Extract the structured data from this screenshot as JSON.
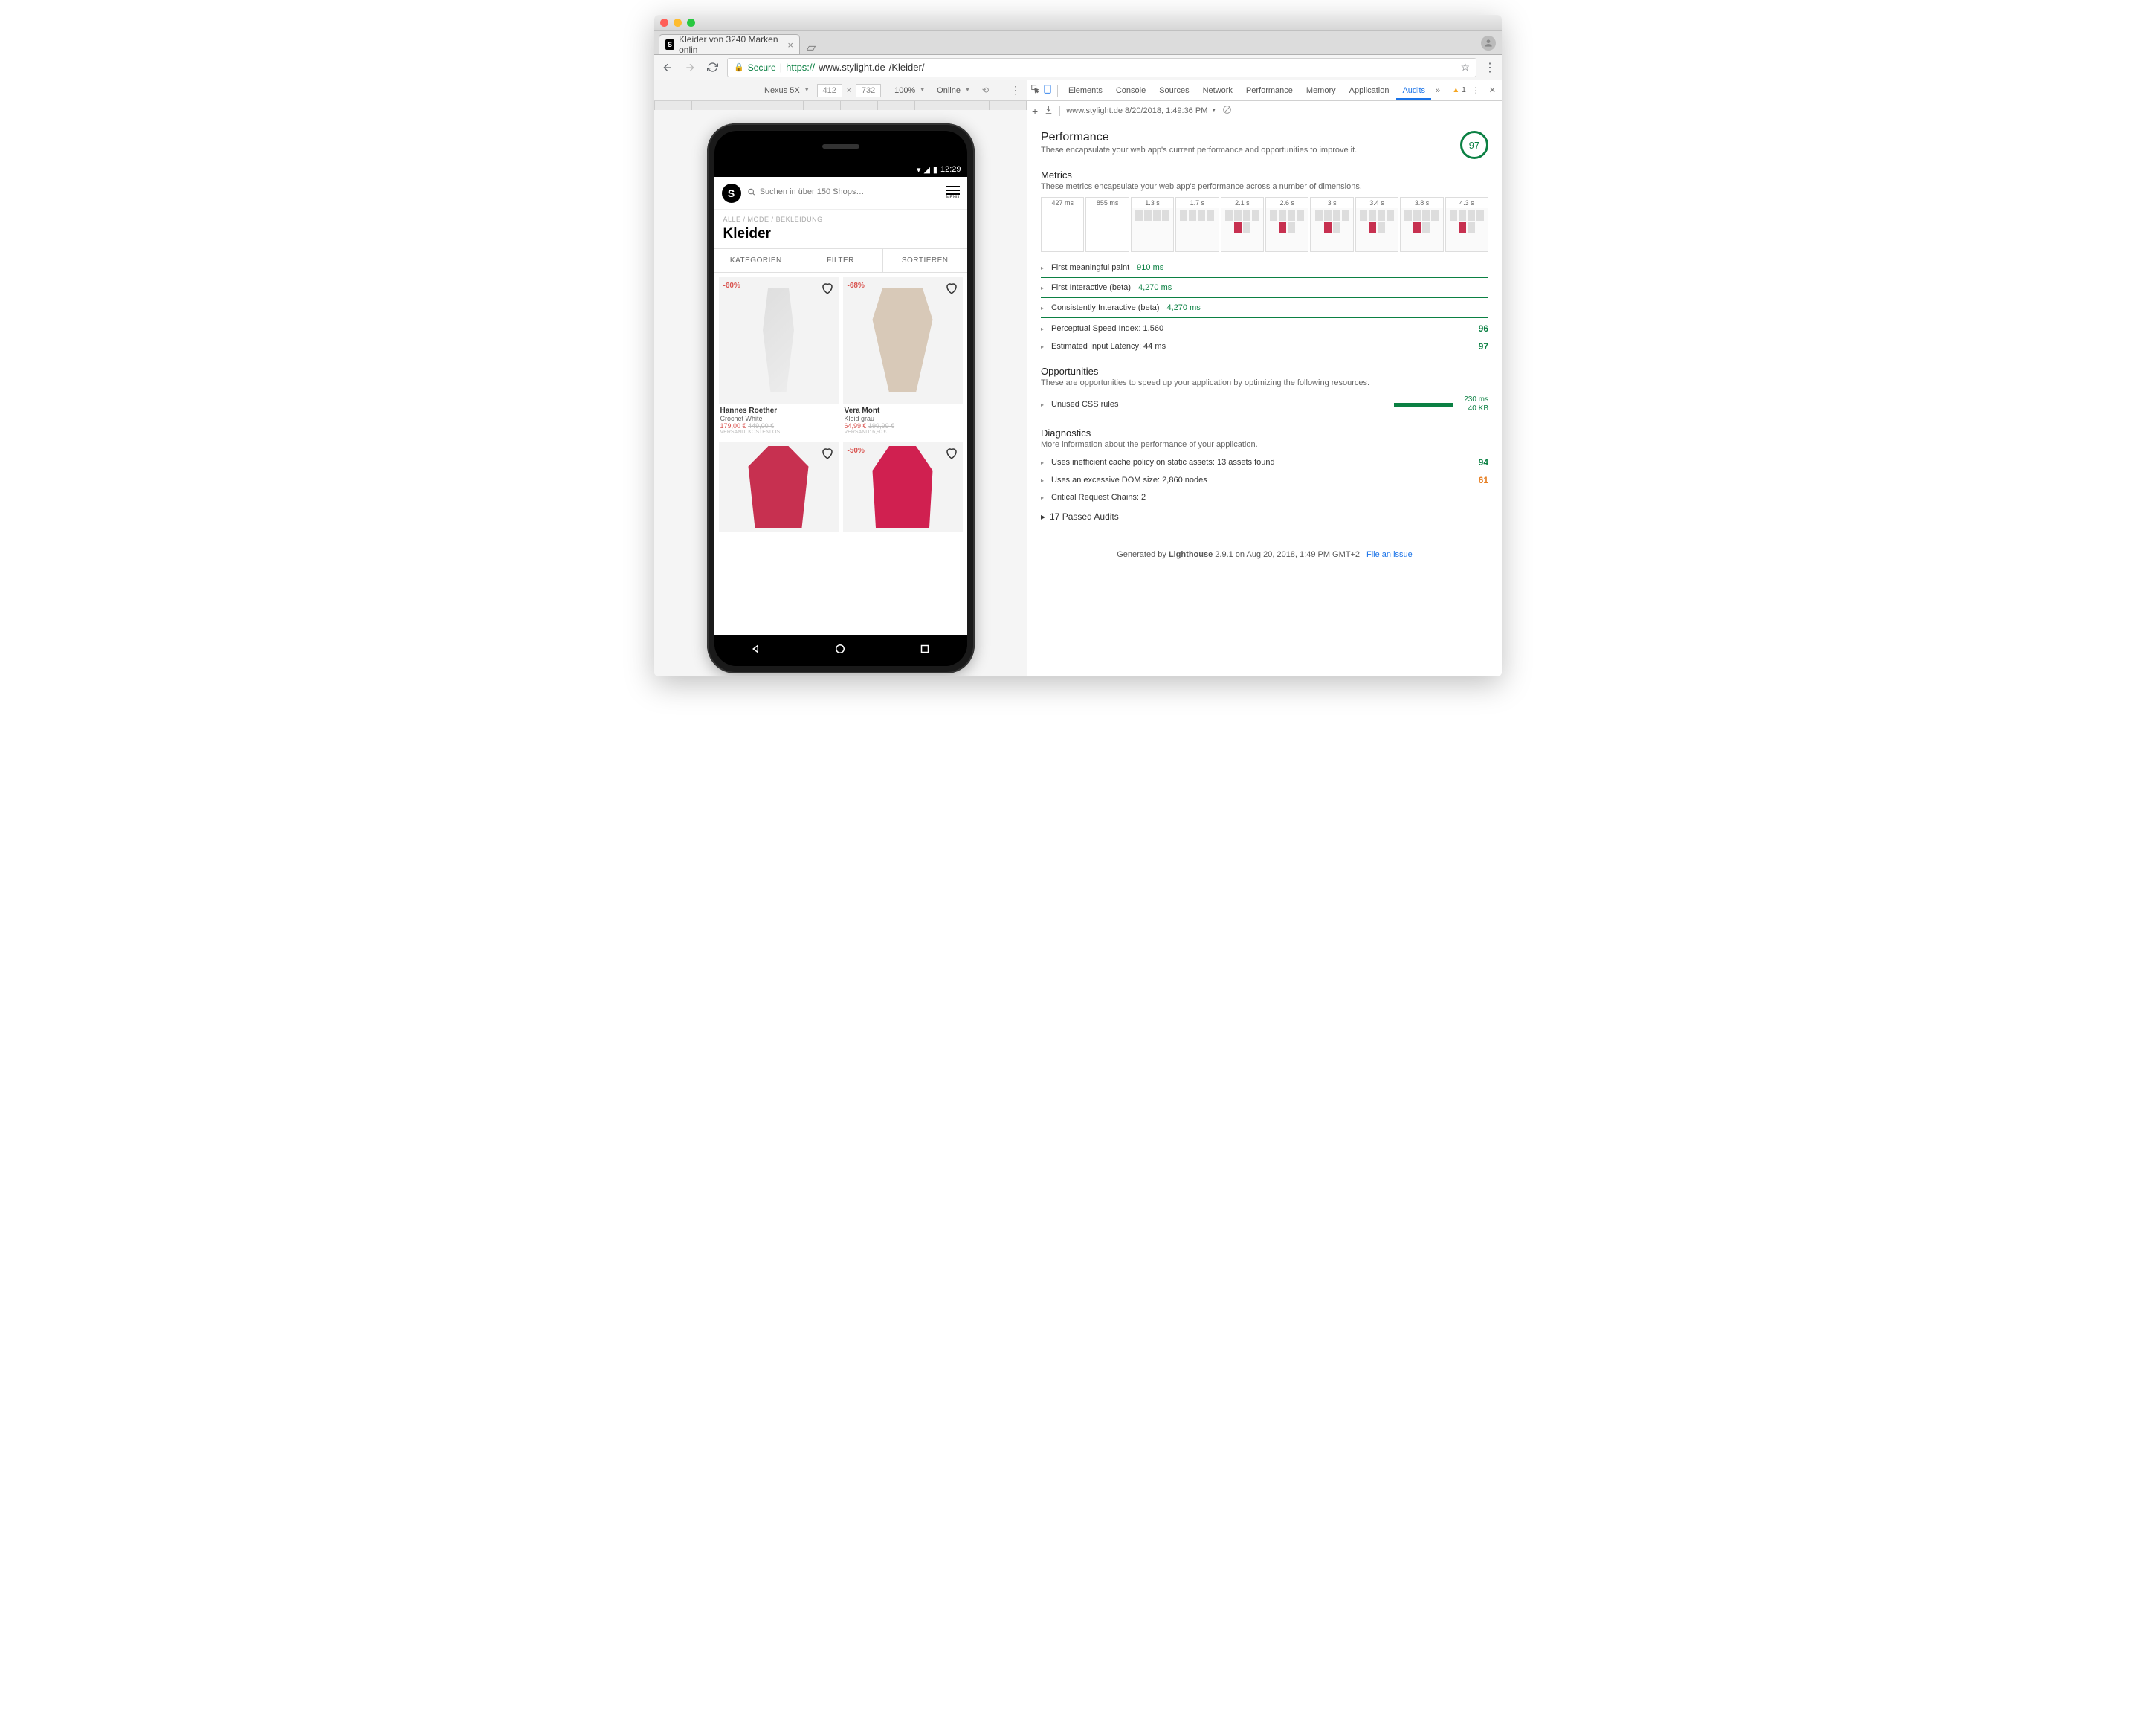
{
  "browser": {
    "tab_title": "Kleider von 3240 Marken onlin",
    "secure_label": "Secure",
    "url_protocol": "https://",
    "url_host": "www.stylight.de",
    "url_path": "/Kleider/"
  },
  "device_toolbar": {
    "device": "Nexus 5X",
    "width": "412",
    "height": "732",
    "zoom": "100%",
    "throttle": "Online"
  },
  "phone": {
    "status_time": "12:29",
    "search_placeholder": "Suchen in über 150 Shops…",
    "menu_label": "MENÜ",
    "crumbs": [
      "ALLE",
      "MODE",
      "BEKLEIDUNG"
    ],
    "heading": "Kleider",
    "tabs": [
      "KATEGORIEN",
      "FILTER",
      "SORTIEREN"
    ],
    "products": [
      {
        "badge": "-60%",
        "brand": "Hannes Roether",
        "name": "Crochet White",
        "sale": "179,00 €",
        "old": "449,00 €",
        "ship": "VERSAND: KOSTENLOS"
      },
      {
        "badge": "-68%",
        "brand": "Vera Mont",
        "name": "Kleid grau",
        "sale": "64,99 €",
        "old": "199,99 €",
        "ship": "VERSAND: 6,90 €"
      },
      {
        "badge": "",
        "brand": "",
        "name": "",
        "sale": "",
        "old": "",
        "ship": ""
      },
      {
        "badge": "-50%",
        "brand": "",
        "name": "",
        "sale": "",
        "old": "",
        "ship": ""
      }
    ]
  },
  "devtools": {
    "tabs": [
      "Elements",
      "Console",
      "Sources",
      "Network",
      "Performance",
      "Memory",
      "Application",
      "Audits"
    ],
    "active_tab": "Audits",
    "warning_count": "1",
    "audit_run": "www.stylight.de 8/20/2018, 1:49:36 PM",
    "performance": {
      "title": "Performance",
      "subtitle": "These encapsulate your web app's current performance and opportunities to improve it.",
      "score": "97"
    },
    "metrics": {
      "title": "Metrics",
      "subtitle": "These metrics encapsulate your web app's performance across a number of dimensions.",
      "timestamps": [
        "427 ms",
        "855 ms",
        "1.3 s",
        "1.7 s",
        "2.1 s",
        "2.6 s",
        "3 s",
        "3.4 s",
        "3.8 s",
        "4.3 s"
      ],
      "items": [
        {
          "label": "First meaningful paint",
          "value": "910 ms",
          "hl": true
        },
        {
          "label": "First Interactive (beta)",
          "value": "4,270 ms",
          "hl": true
        },
        {
          "label": "Consistently Interactive (beta)",
          "value": "4,270 ms",
          "hl": true
        },
        {
          "label": "Perceptual Speed Index: 1,560",
          "value": "",
          "score": "96"
        },
        {
          "label": "Estimated Input Latency: 44 ms",
          "value": "",
          "score": "97"
        }
      ]
    },
    "opportunities": {
      "title": "Opportunities",
      "subtitle": "These are opportunities to speed up your application by optimizing the following resources.",
      "items": [
        {
          "label": "Unused CSS rules",
          "time": "230 ms",
          "size": "40 KB"
        }
      ]
    },
    "diagnostics": {
      "title": "Diagnostics",
      "subtitle": "More information about the performance of your application.",
      "items": [
        {
          "label": "Uses inefficient cache policy on static assets: 13 assets found",
          "score": "94",
          "cls": ""
        },
        {
          "label": "Uses an excessive DOM size: 2,860 nodes",
          "score": "61",
          "cls": "orange"
        },
        {
          "label": "Critical Request Chains: 2",
          "score": "",
          "cls": ""
        }
      ]
    },
    "passed": "17 Passed Audits",
    "footer": {
      "prefix": "Generated by ",
      "tool": "Lighthouse",
      "rest": " 2.9.1 on Aug 20, 2018, 1:49 PM GMT+2 | ",
      "link": "File an issue"
    }
  }
}
